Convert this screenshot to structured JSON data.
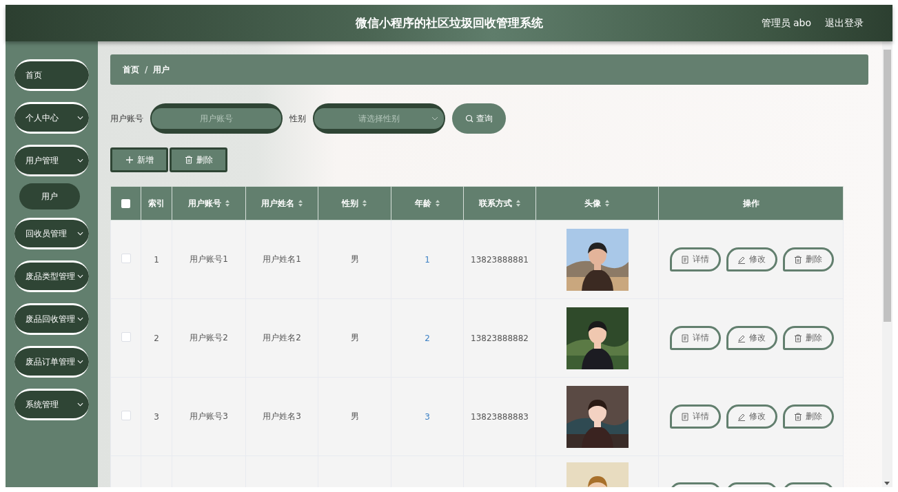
{
  "header": {
    "title": "微信小程序的社区垃圾回收管理系统",
    "user": "管理员 abo",
    "logout": "退出登录"
  },
  "sidebar": {
    "items": [
      {
        "label": "首页",
        "has_submenu": false,
        "expanded": false
      },
      {
        "label": "个人中心",
        "has_submenu": true,
        "expanded": false
      },
      {
        "label": "用户管理",
        "has_submenu": true,
        "expanded": true,
        "children": [
          {
            "label": "用户"
          }
        ]
      },
      {
        "label": "回收员管理",
        "has_submenu": true,
        "expanded": false
      },
      {
        "label": "废品类型管理",
        "has_submenu": true,
        "expanded": false
      },
      {
        "label": "废品回收管理",
        "has_submenu": true,
        "expanded": false
      },
      {
        "label": "废品订单管理",
        "has_submenu": true,
        "expanded": false
      },
      {
        "label": "系统管理",
        "has_submenu": true,
        "expanded": false
      }
    ]
  },
  "breadcrumb": {
    "items": [
      "首页",
      "用户"
    ],
    "separator": "/"
  },
  "search": {
    "fields": [
      {
        "kind": "input",
        "label": "用户账号",
        "placeholder": "用户账号"
      },
      {
        "kind": "select",
        "label": "性别",
        "placeholder": "请选择性别"
      }
    ],
    "button": "查询"
  },
  "toolbar": [
    {
      "kind": "add",
      "label": "新增"
    },
    {
      "kind": "delete",
      "label": "删除"
    }
  ],
  "table": {
    "select_all": {
      "checked": false
    },
    "columns": [
      {
        "label": "索引",
        "sortable": false
      },
      {
        "label": "用户账号",
        "sortable": true
      },
      {
        "label": "用户姓名",
        "sortable": true
      },
      {
        "label": "性别",
        "sortable": true
      },
      {
        "label": "年龄",
        "sortable": true
      },
      {
        "label": "联系方式",
        "sortable": true
      },
      {
        "label": "头像",
        "sortable": true
      },
      {
        "label": "操作",
        "sortable": false
      }
    ],
    "rows": [
      {
        "checked": false,
        "index": "1",
        "account": "用户账号1",
        "name": "用户姓名1",
        "gender": "男",
        "age": "1",
        "phone": "13823888881",
        "actions": [
          {
            "kind": "detail",
            "label": "详情"
          },
          {
            "kind": "edit",
            "label": "修改"
          },
          {
            "kind": "delete",
            "label": "删除"
          }
        ]
      },
      {
        "checked": false,
        "index": "2",
        "account": "用户账号2",
        "name": "用户姓名2",
        "gender": "男",
        "age": "2",
        "phone": "13823888882",
        "actions": [
          {
            "kind": "detail",
            "label": "详情"
          },
          {
            "kind": "edit",
            "label": "修改"
          },
          {
            "kind": "delete",
            "label": "删除"
          }
        ]
      },
      {
        "checked": false,
        "index": "3",
        "account": "用户账号3",
        "name": "用户姓名3",
        "gender": "男",
        "age": "3",
        "phone": "13823888883",
        "actions": [
          {
            "kind": "detail",
            "label": "详情"
          },
          {
            "kind": "edit",
            "label": "修改"
          },
          {
            "kind": "delete",
            "label": "删除"
          }
        ]
      }
    ],
    "partial_row": true
  }
}
